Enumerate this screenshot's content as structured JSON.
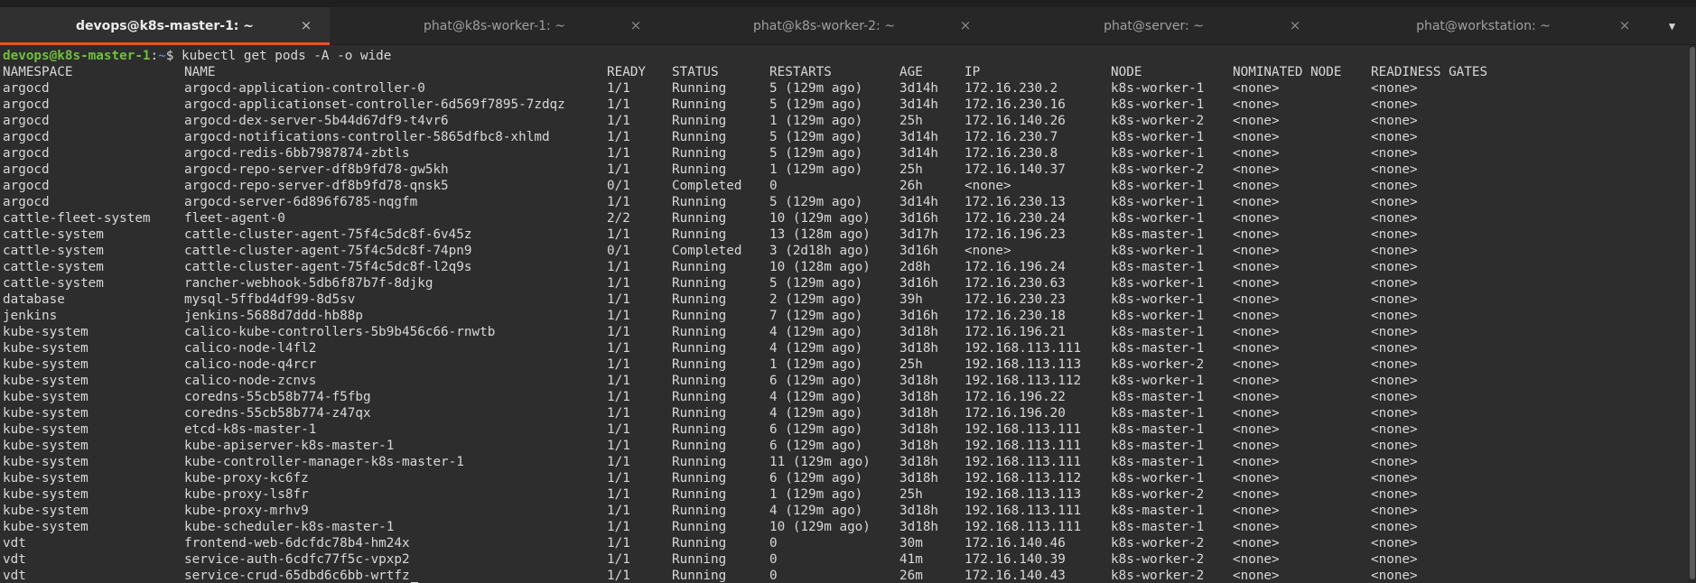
{
  "colors": {
    "terminal_bg": "#2d2d2d",
    "tab_active_indicator": "#e95420",
    "prompt_user": "#6fc13c",
    "prompt_path": "#5f86c9",
    "text": "#d8d8d8"
  },
  "tabs": [
    {
      "label": "devops@k8s-master-1: ~",
      "active": true,
      "close_icon": "close-icon",
      "close_glyph": "×"
    },
    {
      "label": "phat@k8s-worker-1: ~",
      "active": false,
      "close_icon": "close-icon",
      "close_glyph": "×"
    },
    {
      "label": "phat@k8s-worker-2: ~",
      "active": false,
      "close_icon": "close-icon",
      "close_glyph": "×"
    },
    {
      "label": "phat@server: ~",
      "active": false,
      "close_icon": "close-icon",
      "close_glyph": "×"
    },
    {
      "label": "phat@workstation: ~",
      "active": false,
      "close_icon": "close-icon",
      "close_glyph": "×"
    }
  ],
  "tab_menu": {
    "icon": "chevron-down-icon",
    "glyph": "▼"
  },
  "terminal": {
    "prompt": {
      "user_host": "devops@k8s-master-1",
      "sep": ":",
      "path": "~",
      "symbol": "$ ",
      "command": "kubectl get pods -A -o wide"
    },
    "headers": {
      "namespace": "NAMESPACE",
      "name": "NAME",
      "ready": "READY",
      "status": "STATUS",
      "restarts": "RESTARTS",
      "age": "AGE",
      "ip": "IP",
      "node": "NODE",
      "nominated_node": "NOMINATED NODE",
      "readiness_gates": "READINESS GATES"
    },
    "rows": [
      [
        "argocd",
        "argocd-application-controller-0",
        "1/1",
        "Running",
        "5 (129m ago)",
        "3d14h",
        "172.16.230.2",
        "k8s-worker-1",
        "<none>",
        "<none>"
      ],
      [
        "argocd",
        "argocd-applicationset-controller-6d569f7895-7zdqz",
        "1/1",
        "Running",
        "5 (129m ago)",
        "3d14h",
        "172.16.230.16",
        "k8s-worker-1",
        "<none>",
        "<none>"
      ],
      [
        "argocd",
        "argocd-dex-server-5b44d67df9-t4vr6",
        "1/1",
        "Running",
        "1 (129m ago)",
        "25h",
        "172.16.140.26",
        "k8s-worker-2",
        "<none>",
        "<none>"
      ],
      [
        "argocd",
        "argocd-notifications-controller-5865dfbc8-xhlmd",
        "1/1",
        "Running",
        "5 (129m ago)",
        "3d14h",
        "172.16.230.7",
        "k8s-worker-1",
        "<none>",
        "<none>"
      ],
      [
        "argocd",
        "argocd-redis-6bb7987874-zbtls",
        "1/1",
        "Running",
        "5 (129m ago)",
        "3d14h",
        "172.16.230.8",
        "k8s-worker-1",
        "<none>",
        "<none>"
      ],
      [
        "argocd",
        "argocd-repo-server-df8b9fd78-gw5kh",
        "1/1",
        "Running",
        "1 (129m ago)",
        "25h",
        "172.16.140.37",
        "k8s-worker-2",
        "<none>",
        "<none>"
      ],
      [
        "argocd",
        "argocd-repo-server-df8b9fd78-qnsk5",
        "0/1",
        "Completed",
        "0",
        "26h",
        "<none>",
        "k8s-worker-1",
        "<none>",
        "<none>"
      ],
      [
        "argocd",
        "argocd-server-6d896f6785-nqgfm",
        "1/1",
        "Running",
        "5 (129m ago)",
        "3d14h",
        "172.16.230.13",
        "k8s-worker-1",
        "<none>",
        "<none>"
      ],
      [
        "cattle-fleet-system",
        "fleet-agent-0",
        "2/2",
        "Running",
        "10 (129m ago)",
        "3d16h",
        "172.16.230.24",
        "k8s-worker-1",
        "<none>",
        "<none>"
      ],
      [
        "cattle-system",
        "cattle-cluster-agent-75f4c5dc8f-6v45z",
        "1/1",
        "Running",
        "13 (128m ago)",
        "3d17h",
        "172.16.196.23",
        "k8s-master-1",
        "<none>",
        "<none>"
      ],
      [
        "cattle-system",
        "cattle-cluster-agent-75f4c5dc8f-74pn9",
        "0/1",
        "Completed",
        "3 (2d18h ago)",
        "3d16h",
        "<none>",
        "k8s-worker-1",
        "<none>",
        "<none>"
      ],
      [
        "cattle-system",
        "cattle-cluster-agent-75f4c5dc8f-l2q9s",
        "1/1",
        "Running",
        "10 (128m ago)",
        "2d8h",
        "172.16.196.24",
        "k8s-master-1",
        "<none>",
        "<none>"
      ],
      [
        "cattle-system",
        "rancher-webhook-5db6f87b7f-8djkg",
        "1/1",
        "Running",
        "5 (129m ago)",
        "3d16h",
        "172.16.230.63",
        "k8s-worker-1",
        "<none>",
        "<none>"
      ],
      [
        "database",
        "mysql-5ffbd4df99-8d5sv",
        "1/1",
        "Running",
        "2 (129m ago)",
        "39h",
        "172.16.230.23",
        "k8s-worker-1",
        "<none>",
        "<none>"
      ],
      [
        "jenkins",
        "jenkins-5688d7ddd-hb88p",
        "1/1",
        "Running",
        "7 (129m ago)",
        "3d16h",
        "172.16.230.18",
        "k8s-worker-1",
        "<none>",
        "<none>"
      ],
      [
        "kube-system",
        "calico-kube-controllers-5b9b456c66-rnwtb",
        "1/1",
        "Running",
        "4 (129m ago)",
        "3d18h",
        "172.16.196.21",
        "k8s-master-1",
        "<none>",
        "<none>"
      ],
      [
        "kube-system",
        "calico-node-l4fl2",
        "1/1",
        "Running",
        "4 (129m ago)",
        "3d18h",
        "192.168.113.111",
        "k8s-master-1",
        "<none>",
        "<none>"
      ],
      [
        "kube-system",
        "calico-node-q4rcr",
        "1/1",
        "Running",
        "1 (129m ago)",
        "25h",
        "192.168.113.113",
        "k8s-worker-2",
        "<none>",
        "<none>"
      ],
      [
        "kube-system",
        "calico-node-zcnvs",
        "1/1",
        "Running",
        "6 (129m ago)",
        "3d18h",
        "192.168.113.112",
        "k8s-worker-1",
        "<none>",
        "<none>"
      ],
      [
        "kube-system",
        "coredns-55cb58b774-f5fbg",
        "1/1",
        "Running",
        "4 (129m ago)",
        "3d18h",
        "172.16.196.22",
        "k8s-master-1",
        "<none>",
        "<none>"
      ],
      [
        "kube-system",
        "coredns-55cb58b774-z47qx",
        "1/1",
        "Running",
        "4 (129m ago)",
        "3d18h",
        "172.16.196.20",
        "k8s-master-1",
        "<none>",
        "<none>"
      ],
      [
        "kube-system",
        "etcd-k8s-master-1",
        "1/1",
        "Running",
        "6 (129m ago)",
        "3d18h",
        "192.168.113.111",
        "k8s-master-1",
        "<none>",
        "<none>"
      ],
      [
        "kube-system",
        "kube-apiserver-k8s-master-1",
        "1/1",
        "Running",
        "6 (129m ago)",
        "3d18h",
        "192.168.113.111",
        "k8s-master-1",
        "<none>",
        "<none>"
      ],
      [
        "kube-system",
        "kube-controller-manager-k8s-master-1",
        "1/1",
        "Running",
        "11 (129m ago)",
        "3d18h",
        "192.168.113.111",
        "k8s-master-1",
        "<none>",
        "<none>"
      ],
      [
        "kube-system",
        "kube-proxy-kc6fz",
        "1/1",
        "Running",
        "6 (129m ago)",
        "3d18h",
        "192.168.113.112",
        "k8s-worker-1",
        "<none>",
        "<none>"
      ],
      [
        "kube-system",
        "kube-proxy-ls8fr",
        "1/1",
        "Running",
        "1 (129m ago)",
        "25h",
        "192.168.113.113",
        "k8s-worker-2",
        "<none>",
        "<none>"
      ],
      [
        "kube-system",
        "kube-proxy-mrhv9",
        "1/1",
        "Running",
        "4 (129m ago)",
        "3d18h",
        "192.168.113.111",
        "k8s-master-1",
        "<none>",
        "<none>"
      ],
      [
        "kube-system",
        "kube-scheduler-k8s-master-1",
        "1/1",
        "Running",
        "10 (129m ago)",
        "3d18h",
        "192.168.113.111",
        "k8s-master-1",
        "<none>",
        "<none>"
      ],
      [
        "vdt",
        "frontend-web-6dcfdc78b4-hm24x",
        "1/1",
        "Running",
        "0",
        "30m",
        "172.16.140.46",
        "k8s-worker-2",
        "<none>",
        "<none>"
      ],
      [
        "vdt",
        "service-auth-6cdfc77f5c-vpxp2",
        "1/1",
        "Running",
        "0",
        "41m",
        "172.16.140.39",
        "k8s-worker-2",
        "<none>",
        "<none>"
      ],
      [
        "vdt",
        "service-crud-65dbd6c6bb-wrtfz",
        "1/1",
        "Running",
        "0",
        "26m",
        "172.16.140.43",
        "k8s-worker-2",
        "<none>",
        "<none>"
      ]
    ]
  }
}
